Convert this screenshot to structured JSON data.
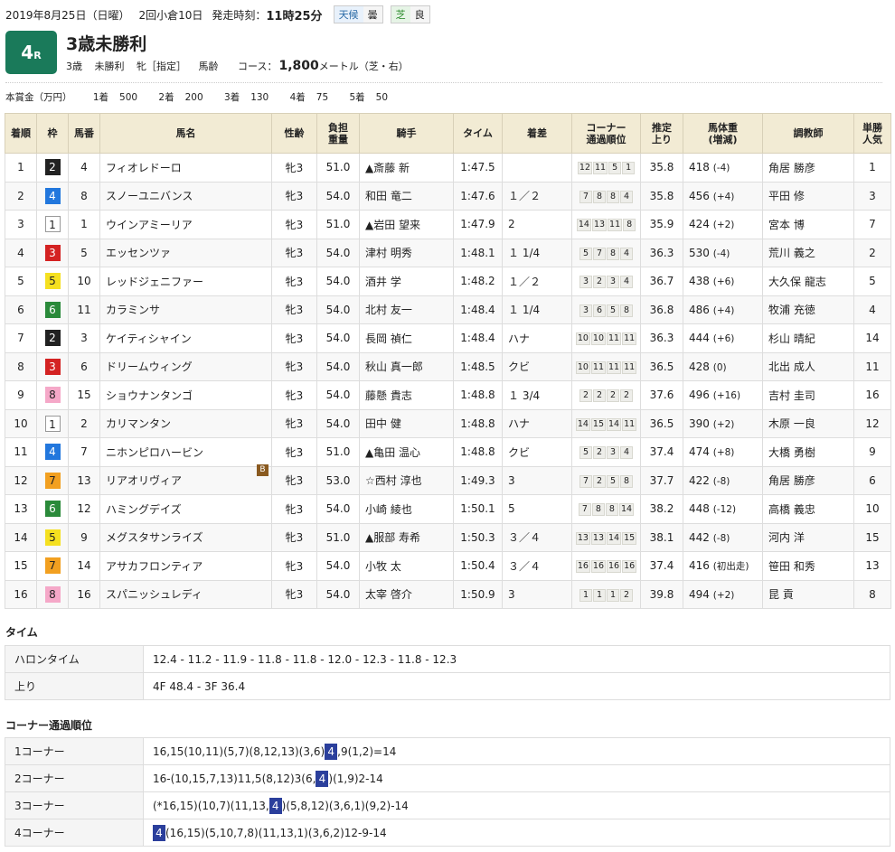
{
  "header": {
    "date_label": "2019年8月25日（日曜）",
    "meeting": "2回小倉10日",
    "start_label": "発走時刻：",
    "start_time": "11時25分",
    "weather_label": "天候",
    "weather_value": "曇",
    "track_label": "芝",
    "track_value": "良"
  },
  "race": {
    "number": "4",
    "r_suffix": "R",
    "title": "3歳未勝利",
    "conditions": [
      "3歳",
      "未勝利",
      "牝［指定］",
      "馬齢"
    ],
    "course_label": "コース：",
    "distance": "1,800",
    "distance_suffix": "メートル（芝・右）"
  },
  "prize": {
    "label": "本賞金（万円）",
    "items": [
      {
        "place": "1着",
        "amount": "500"
      },
      {
        "place": "2着",
        "amount": "200"
      },
      {
        "place": "3着",
        "amount": "130"
      },
      {
        "place": "4着",
        "amount": "75"
      },
      {
        "place": "5着",
        "amount": "50"
      }
    ]
  },
  "table": {
    "headers": {
      "rank": "着順",
      "frame": "枠",
      "num": "馬番",
      "horse": "馬名",
      "sexage": "性齢",
      "weight_a": "負担",
      "weight_b": "重量",
      "jockey": "騎手",
      "time": "タイム",
      "margin": "着差",
      "corner_a": "コーナー",
      "corner_b": "通過順位",
      "last_a": "推定",
      "last_b": "上り",
      "body_a": "馬体重",
      "body_b": "(増減)",
      "trainer": "調教師",
      "pop_a": "単勝",
      "pop_b": "人気"
    },
    "rows": [
      {
        "rank": "1",
        "frame": "2",
        "num": "4",
        "horse": "フィオレドーロ",
        "sexage": "牝3",
        "weight": "51.0",
        "jockey": "▲斎藤 新",
        "time": "1:47.5",
        "margin": "",
        "corners": [
          "12",
          "11",
          "5",
          "1"
        ],
        "last3f": "35.8",
        "body": "418",
        "change": "(-4)",
        "trainer": "角居 勝彦",
        "pop": "1"
      },
      {
        "rank": "2",
        "frame": "4",
        "num": "8",
        "horse": "スノーユニバンス",
        "sexage": "牝3",
        "weight": "54.0",
        "jockey": "和田 竜二",
        "time": "1:47.6",
        "margin": "１／２",
        "corners": [
          "7",
          "8",
          "8",
          "4"
        ],
        "last3f": "35.8",
        "body": "456",
        "change": "(+4)",
        "trainer": "平田 修",
        "pop": "3"
      },
      {
        "rank": "3",
        "frame": "1",
        "num": "1",
        "horse": "ウインアミーリア",
        "sexage": "牝3",
        "weight": "51.0",
        "jockey": "▲岩田 望来",
        "time": "1:47.9",
        "margin": "2",
        "corners": [
          "14",
          "13",
          "11",
          "8"
        ],
        "last3f": "35.9",
        "body": "424",
        "change": "(+2)",
        "trainer": "宮本 博",
        "pop": "7"
      },
      {
        "rank": "4",
        "frame": "3",
        "num": "5",
        "horse": "エッセンツァ",
        "sexage": "牝3",
        "weight": "54.0",
        "jockey": "津村 明秀",
        "time": "1:48.1",
        "margin": "１ 1/4",
        "corners": [
          "5",
          "7",
          "8",
          "4"
        ],
        "last3f": "36.3",
        "body": "530",
        "change": "(-4)",
        "trainer": "荒川 義之",
        "pop": "2"
      },
      {
        "rank": "5",
        "frame": "5",
        "num": "10",
        "horse": "レッドジェニファー",
        "sexage": "牝3",
        "weight": "54.0",
        "jockey": "酒井 学",
        "time": "1:48.2",
        "margin": "１／２",
        "corners": [
          "3",
          "2",
          "3",
          "4"
        ],
        "last3f": "36.7",
        "body": "438",
        "change": "(+6)",
        "trainer": "大久保 龍志",
        "pop": "5"
      },
      {
        "rank": "6",
        "frame": "6",
        "num": "11",
        "horse": "カラミンサ",
        "sexage": "牝3",
        "weight": "54.0",
        "jockey": "北村 友一",
        "time": "1:48.4",
        "margin": "１ 1/4",
        "corners": [
          "3",
          "6",
          "5",
          "8"
        ],
        "last3f": "36.8",
        "body": "486",
        "change": "(+4)",
        "trainer": "牧浦 充徳",
        "pop": "4"
      },
      {
        "rank": "7",
        "frame": "2",
        "num": "3",
        "horse": "ケイティシャイン",
        "sexage": "牝3",
        "weight": "54.0",
        "jockey": "長岡 禎仁",
        "time": "1:48.4",
        "margin": "ハナ",
        "corners": [
          "10",
          "10",
          "11",
          "11"
        ],
        "last3f": "36.3",
        "body": "444",
        "change": "(+6)",
        "trainer": "杉山 晴紀",
        "pop": "14"
      },
      {
        "rank": "8",
        "frame": "3",
        "num": "6",
        "horse": "ドリームウィング",
        "sexage": "牝3",
        "weight": "54.0",
        "jockey": "秋山 真一郎",
        "time": "1:48.5",
        "margin": "クビ",
        "corners": [
          "10",
          "11",
          "11",
          "11"
        ],
        "last3f": "36.5",
        "body": "428",
        "change": "(0)",
        "trainer": "北出 成人",
        "pop": "11"
      },
      {
        "rank": "9",
        "frame": "8",
        "num": "15",
        "horse": "ショウナンタンゴ",
        "sexage": "牝3",
        "weight": "54.0",
        "jockey": "藤懸 貴志",
        "time": "1:48.8",
        "margin": "１ 3/4",
        "corners": [
          "2",
          "2",
          "2",
          "2"
        ],
        "last3f": "37.6",
        "body": "496",
        "change": "(+16)",
        "trainer": "吉村 圭司",
        "pop": "16"
      },
      {
        "rank": "10",
        "frame": "1",
        "num": "2",
        "horse": "カリマンタン",
        "sexage": "牝3",
        "weight": "54.0",
        "jockey": "田中 健",
        "time": "1:48.8",
        "margin": "ハナ",
        "corners": [
          "14",
          "15",
          "14",
          "11"
        ],
        "last3f": "36.5",
        "body": "390",
        "change": "(+2)",
        "trainer": "木原 一良",
        "pop": "12"
      },
      {
        "rank": "11",
        "frame": "4",
        "num": "7",
        "horse": "ニホンピロハービン",
        "sexage": "牝3",
        "weight": "51.0",
        "jockey": "▲亀田 温心",
        "time": "1:48.8",
        "margin": "クビ",
        "corners": [
          "5",
          "2",
          "3",
          "4"
        ],
        "last3f": "37.4",
        "body": "474",
        "change": "(+8)",
        "trainer": "大橋 勇樹",
        "pop": "9"
      },
      {
        "rank": "12",
        "frame": "7",
        "num": "13",
        "horse": "リアオリヴィア",
        "sexage": "牝3",
        "weight": "53.0",
        "jockey": "☆西村 淳也",
        "time": "1:49.3",
        "margin": "3",
        "corners": [
          "7",
          "2",
          "5",
          "8"
        ],
        "last3f": "37.7",
        "body": "422",
        "change": "(-8)",
        "trainer": "角居 勝彦",
        "pop": "6",
        "blinker": "B"
      },
      {
        "rank": "13",
        "frame": "6",
        "num": "12",
        "horse": "ハミングデイズ",
        "sexage": "牝3",
        "weight": "54.0",
        "jockey": "小崎 綾也",
        "time": "1:50.1",
        "margin": "5",
        "corners": [
          "7",
          "8",
          "8",
          "14"
        ],
        "last3f": "38.2",
        "body": "448",
        "change": "(-12)",
        "trainer": "高橋 義忠",
        "pop": "10"
      },
      {
        "rank": "14",
        "frame": "5",
        "num": "9",
        "horse": "メグスタサンライズ",
        "sexage": "牝3",
        "weight": "51.0",
        "jockey": "▲服部 寿希",
        "time": "1:50.3",
        "margin": "３／４",
        "corners": [
          "13",
          "13",
          "14",
          "15"
        ],
        "last3f": "38.1",
        "body": "442",
        "change": "(-8)",
        "trainer": "河内 洋",
        "pop": "15"
      },
      {
        "rank": "15",
        "frame": "7",
        "num": "14",
        "horse": "アサカフロンティア",
        "sexage": "牝3",
        "weight": "54.0",
        "jockey": "小牧 太",
        "time": "1:50.4",
        "margin": "３／４",
        "corners": [
          "16",
          "16",
          "16",
          "16"
        ],
        "last3f": "37.4",
        "body": "416",
        "change": "(初出走)",
        "trainer": "笹田 和秀",
        "pop": "13"
      },
      {
        "rank": "16",
        "frame": "8",
        "num": "16",
        "horse": "スパニッシュレディ",
        "sexage": "牝3",
        "weight": "54.0",
        "jockey": "太宰 啓介",
        "time": "1:50.9",
        "margin": "3",
        "corners": [
          "1",
          "1",
          "1",
          "2"
        ],
        "last3f": "39.8",
        "body": "494",
        "change": "(+2)",
        "trainer": "昆 貢",
        "pop": "8"
      }
    ]
  },
  "timing": {
    "title": "タイム",
    "rows": [
      {
        "label": "ハロンタイム",
        "value": "12.4 - 11.2 - 11.9 - 11.8 - 11.8 - 12.0 - 12.3 - 11.8 - 12.3"
      },
      {
        "label": "上り",
        "value": "4F 48.4 - 3F 36.4"
      }
    ]
  },
  "corners": {
    "title": "コーナー通過順位",
    "highlight": "4",
    "rows": [
      {
        "label": "1コーナー",
        "pre": "16,15(10,11)(5,7)(8,12,13)(3,6)",
        "post": ",9(1,2)=14"
      },
      {
        "label": "2コーナー",
        "pre": "16-(10,15,7,13)11,5(8,12)3(6,",
        "post": ")(1,9)2-14"
      },
      {
        "label": "3コーナー",
        "pre": "(*16,15)(10,7)(11,13,",
        "post": ")(5,8,12)(3,6,1)(9,2)-14"
      },
      {
        "label": "4コーナー",
        "pre": "",
        "post": "(16,15)(5,10,7,8)(11,13,1)(3,6,2)12-9-14"
      }
    ]
  },
  "colors": {
    "frame_1": "#ffffff",
    "frame_2": "#222222",
    "frame_3": "#d42222",
    "frame_4": "#2277dd",
    "frame_5": "#f5e020",
    "frame_6": "#2a8a3a",
    "frame_7": "#f2a020",
    "frame_8": "#f5a8c8",
    "race_badge": "#1a7a5a",
    "highlight": "#2b3f9c",
    "table_header": "#f2ebd4"
  }
}
